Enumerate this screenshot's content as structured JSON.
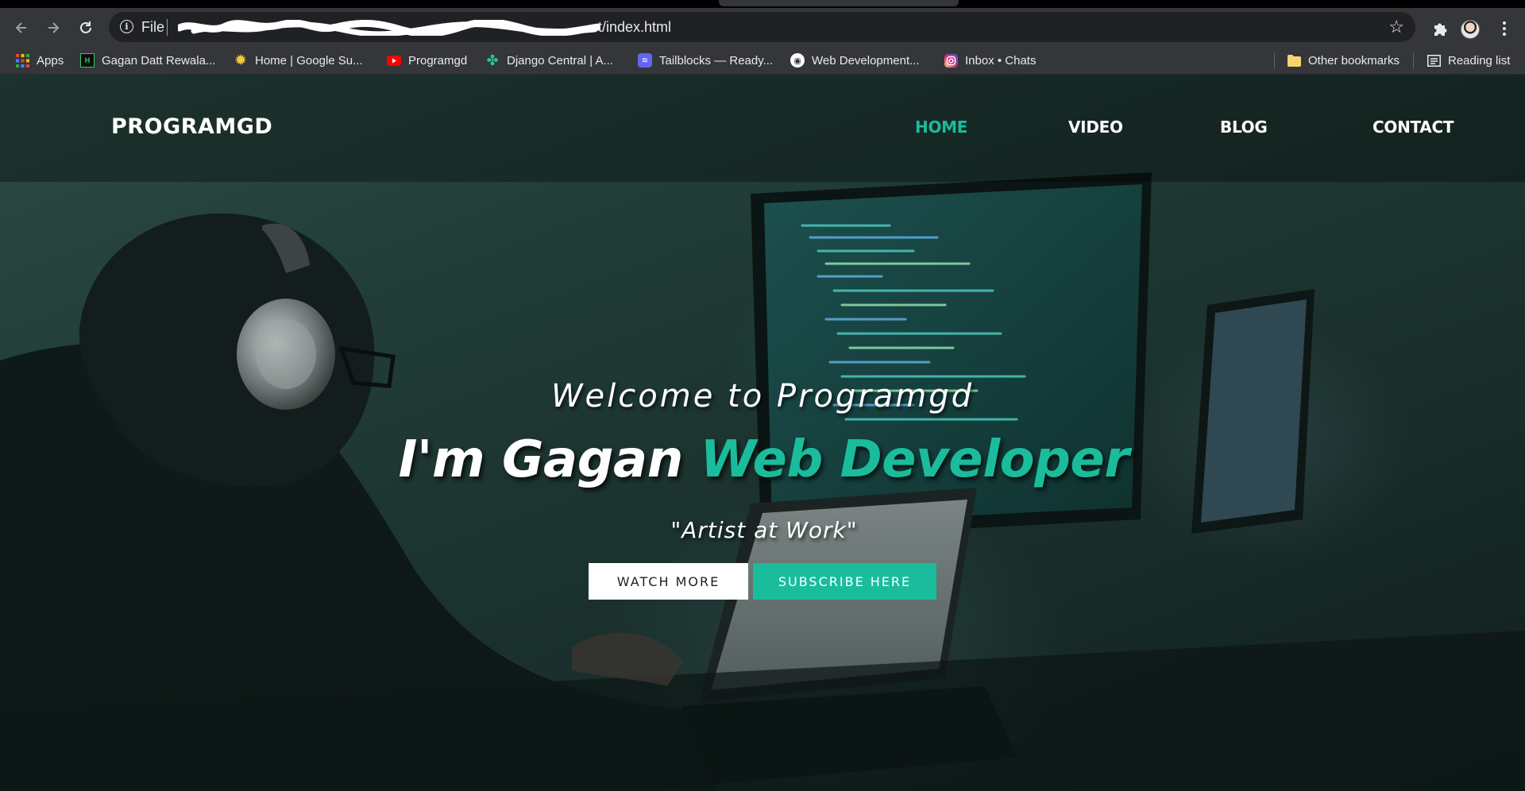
{
  "browser": {
    "url_scheme": "File",
    "url_tail": "t/index.html",
    "icons": {
      "back": "arrow-left-icon",
      "forward": "arrow-right-icon",
      "reload": "reload-icon",
      "site_info": "info-icon",
      "bookmark_star": "star-icon",
      "extensions": "puzzle-icon",
      "menu": "more-vertical-icon"
    }
  },
  "bookmarks": {
    "items": [
      {
        "label": "Apps",
        "icon": "apps-grid-icon"
      },
      {
        "label": "Gagan Datt Rewala...",
        "icon": "hackerrank-icon"
      },
      {
        "label": "Home | Google Su...",
        "icon": "google-sun-icon"
      },
      {
        "label": "Programgd",
        "icon": "youtube-icon"
      },
      {
        "label": "Django Central | A...",
        "icon": "django-central-icon"
      },
      {
        "label": "Tailblocks — Ready...",
        "icon": "tailblocks-icon"
      },
      {
        "label": "Web Development...",
        "icon": "globe-icon"
      },
      {
        "label": "Inbox • Chats",
        "icon": "instagram-icon"
      }
    ],
    "other": {
      "label": "Other bookmarks",
      "icon": "folder-icon"
    },
    "reading_list": {
      "label": "Reading list",
      "icon": "reading-list-icon"
    }
  },
  "site": {
    "logo": "PROGRAMGD",
    "nav": [
      {
        "label": "HOME",
        "active": true
      },
      {
        "label": "VIDEO",
        "active": false
      },
      {
        "label": "BLOG",
        "active": false
      },
      {
        "label": "CONTACT",
        "active": false
      }
    ]
  },
  "hero": {
    "welcome": "Welcome to Programgd",
    "headline_prefix": "I'm Gagan",
    "headline_accent": "Web Developer",
    "tagline": "\"Artist at Work\"",
    "watch_button": "WATCH MORE",
    "subscribe_button": "SUBSCRIBE HERE"
  },
  "colors": {
    "accent": "#1abc9c",
    "chrome_dark": "#35363a",
    "omnibox": "#202124",
    "hero_overlay": "#1c322e"
  }
}
